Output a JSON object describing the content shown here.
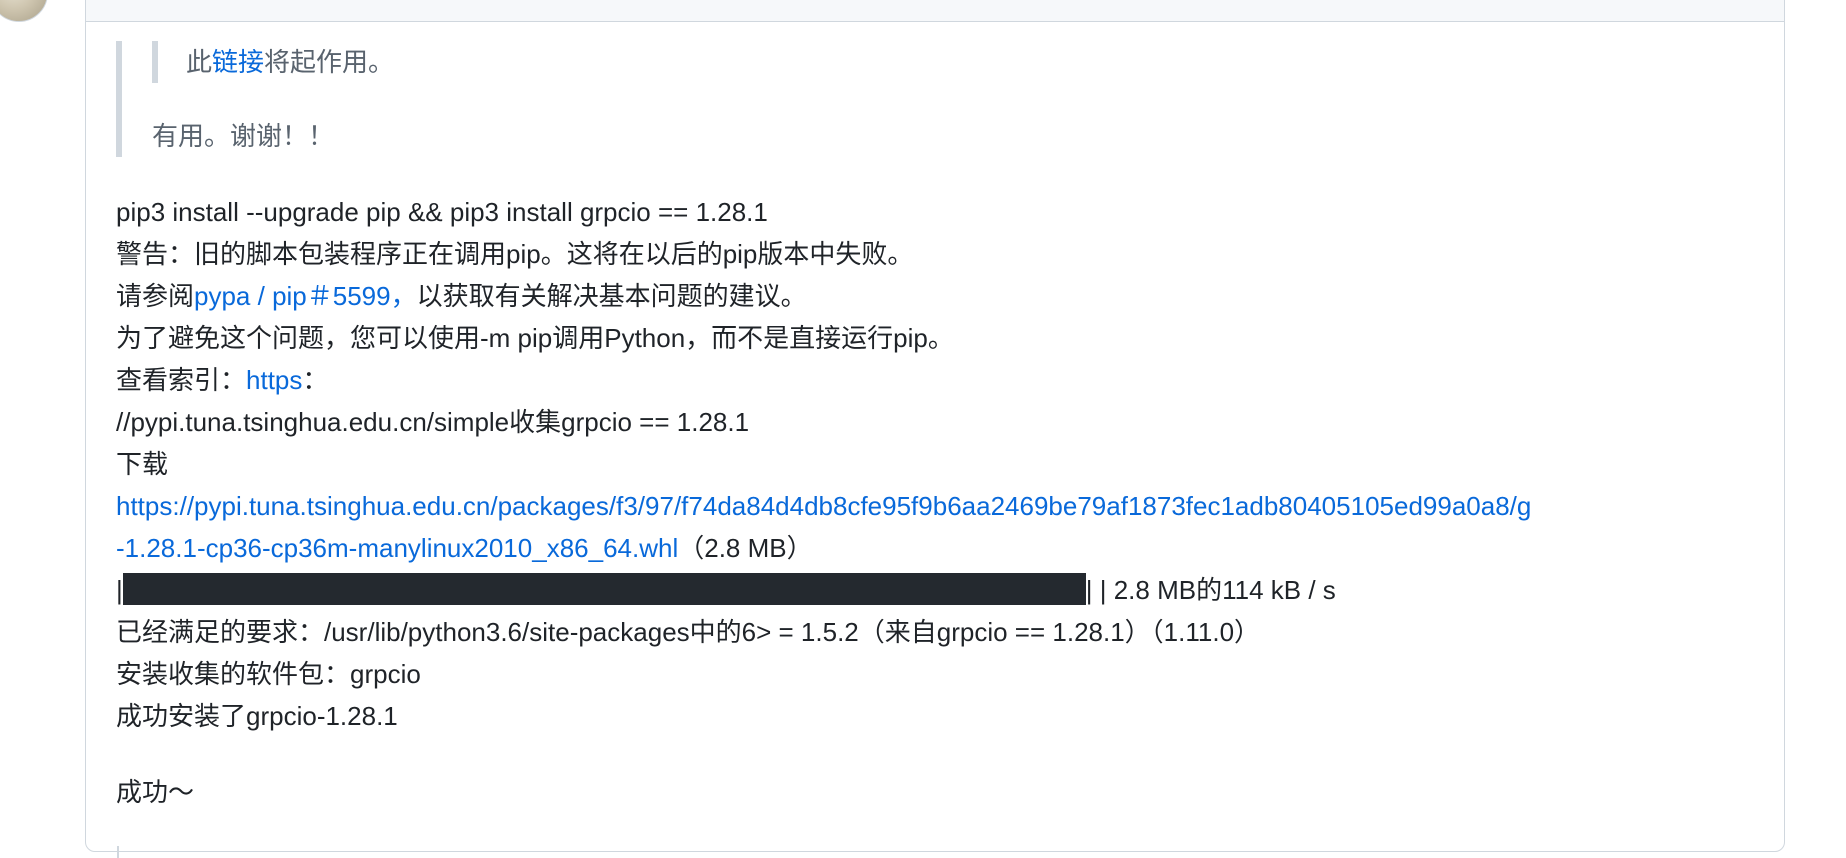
{
  "quote": {
    "inner_prefix": "此",
    "inner_link": "链接",
    "inner_suffix": "将起作用。",
    "outer_text": "有用。谢谢！！"
  },
  "body": {
    "cmd": "pip3 install --upgrade pip && pip3 install grpcio == 1.28.1",
    "warning": "警告：旧的脚本包装程序正在调用pip。这将在以后的pip版本中失败。",
    "see_prefix": "请参阅",
    "see_link": "pypa / pip＃5599，",
    "see_suffix": "以获取有关解决基本问题的建议。",
    "avoid": "为了避免这个问题，您可以使用-m pip调用Python，而不是直接运行pip。",
    "index_prefix": "查看索引：",
    "index_link": "https",
    "index_suffix": "：",
    "collect": "//pypi.tuna.tsinghua.edu.cn/simple收集grpcio == 1.28.1",
    "download_label": "下载",
    "download_link_1": "https://pypi.tuna.tsinghua.edu.cn/packages/f3/97/f74da84d4db8cfe95f9b6aa2469be79af1873fec1adb80405105ed99a0a8/g",
    "download_link_2": "-1.28.1-cp36-cp36m-manylinux2010_x86_64.whl",
    "download_size": "（2.8 MB）",
    "progress_left": "|",
    "progress_right": "| | 2.8 MB的114 kB / s",
    "progress_fraction": 1.0,
    "satisfied": "已经满足的要求：/usr/lib/python3.6/site-packages中的6> = 1.5.2（来自grpcio == 1.28.1）（1.11.0）",
    "installing": "安装收集的软件包：grpcio",
    "success_install": "成功安装了grpcio-1.28.1",
    "final": "成功～"
  },
  "colors": {
    "link": "#0969da",
    "text": "#1f2328",
    "quote_text": "#59636e",
    "border": "#d0d7de",
    "progress": "#24292f"
  }
}
